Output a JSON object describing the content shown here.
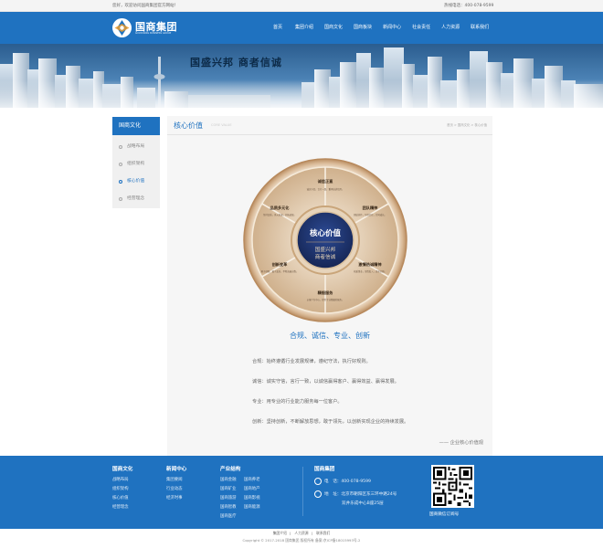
{
  "topbar": {
    "welcome": "您好，欢迎访问国商集团官方网站！",
    "hotline": "热线电话：400-078-9599"
  },
  "logo": {
    "name": "国商集团",
    "sub": "GUOSHANG BUSINESS GROUP"
  },
  "nav": [
    "首页",
    "集团介绍",
    "国商文化",
    "国商板块",
    "新闻中心",
    "社会责任",
    "人力资源",
    "联系我们"
  ],
  "banner": {
    "slogan": "国盛兴邦  商者信诚"
  },
  "sidebar": {
    "title": "国商文化",
    "items": [
      {
        "label": "战略布局"
      },
      {
        "label": "组织架构"
      },
      {
        "label": "核心价值"
      },
      {
        "label": "经营理念"
      }
    ]
  },
  "main": {
    "heading": "核心价值",
    "heading_en": "CORE VALUE",
    "breadcrumb": "首页 > 国商文化 > 核心价值",
    "wheel": {
      "center_title": "核心价值",
      "center_line1": "国盛兴邦",
      "center_line2": "商者信诚",
      "segments": [
        {
          "title": "诚信正直",
          "text": "诚实守信，言行一致，重承诺讲信用。"
        },
        {
          "title": "团队精神",
          "text": "团结协作，互相信任，共同成长。"
        },
        {
          "title": "激情热诚精神",
          "text": "热爱事业，全情投入，追求卓越。"
        },
        {
          "title": "精细服务",
          "text": "以客户为中心，提供专业精细的服务。"
        },
        {
          "title": "创新变革",
          "text": "勇于创新，敢于变革，不断突破自我。"
        },
        {
          "title": "品质多元化",
          "text": "坚持品质，多元发展，开拓进取。"
        }
      ]
    },
    "values_title": "合规、诚信、专业、创新",
    "paragraphs": [
      "合规：始终遵循行业发展规律，遵纪守法，执行好规则。",
      "诚信：诚实守信，言行一致，以诚信赢得客户、赢得效益、赢得发展。",
      "专业：用专业的行业能力服务每一位客户。",
      "创新：坚持创新，不断解放思想，敢于领先，以创新实现企业的持续发展。"
    ],
    "signature": "—— 企业核心价值观"
  },
  "footer": {
    "col1": {
      "title": "国商文化",
      "links": [
        "战略布局",
        "组织架构",
        "核心价值",
        "经营理念"
      ]
    },
    "col2": {
      "title": "新闻中心",
      "links": [
        "集团要闻",
        "行业动态",
        "经济时事"
      ]
    },
    "col3": {
      "title": "产业结构",
      "links": [
        "国商金融",
        "国商养老",
        "国商矿业",
        "国商地产",
        "国商旅游",
        "国商影视",
        "国商智教",
        "国商能源",
        "国商医疗"
      ]
    },
    "contact": {
      "title": "国商集团",
      "phone": "电　话：400-078-9599",
      "address1": "地　址：北京市朝阳区东三环中路24号",
      "address2": "双井乐成中心B座25层"
    },
    "qr_label": "国商微信订阅号"
  },
  "bottom": {
    "links": [
      "集团介绍",
      "人力资源",
      "联系我们"
    ],
    "copyright": "Copyright © 2017-2018 国商集团 版权所有 备案:京ICP备18015993号-2"
  },
  "colors": {
    "brand_blue": "#1f72c0",
    "wheel_navy": "#1c2f6d",
    "wheel_gold": "#c9a57a"
  }
}
